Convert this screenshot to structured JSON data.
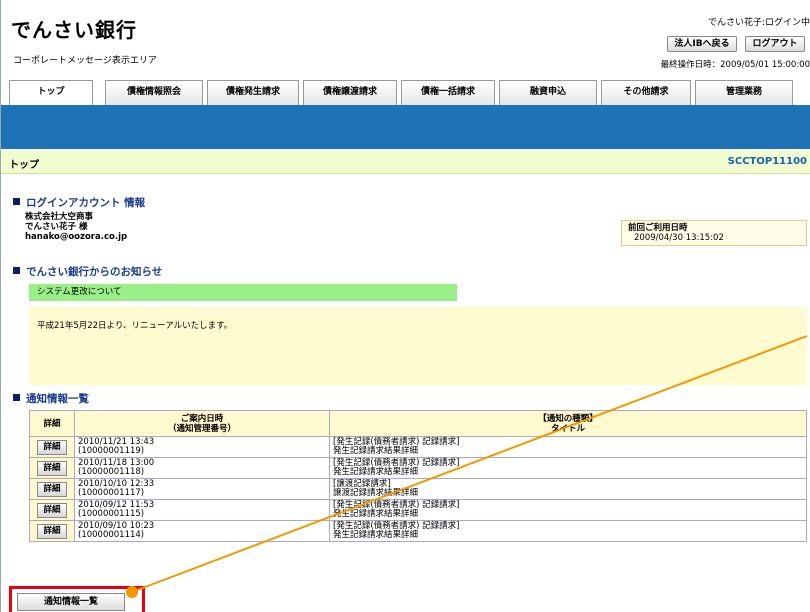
{
  "header": {
    "bank_name": "でんさい銀行",
    "corporate_message": "コーポレートメッセージ表示エリア",
    "user_name": "でんさい花子:ログイン中",
    "ib_return_label": "法人IBへ戻る",
    "logout_label": "ログアウト",
    "last_operation": "最終操作日時：2009/05/01 15:00:00"
  },
  "nav": {
    "tabs": [
      {
        "label": "トップ"
      },
      {
        "label": "債権情報照会"
      },
      {
        "label": "債権発生請求"
      },
      {
        "label": "債権譲渡請求"
      },
      {
        "label": "債権一括請求"
      },
      {
        "label": "融資申込"
      },
      {
        "label": "その他請求"
      },
      {
        "label": "管理業務"
      }
    ]
  },
  "page": {
    "title": "トップ",
    "screen_id": "SCCTOP11100"
  },
  "login_account": {
    "heading": "ログインアカウント 情報",
    "company": "株式会社大空商事",
    "user": "でんさい花子 様",
    "email": "hanako@oozora.co.jp",
    "prev_login_label": "前回ご利用日時",
    "prev_login_value": "2009/04/30 13:15:02"
  },
  "notices": {
    "heading": "でんさい銀行からのお知らせ",
    "title": "システム更改について",
    "body": "平成21年5月22日より、リニューアルいたします。"
  },
  "notifications": {
    "heading": "通知情報一覧",
    "col_detail": "詳細",
    "col_date_line1": "ご案内日時",
    "col_date_line2": "（通知管理番号）",
    "col_type_line1": "【通知の種類】",
    "col_type_line2": "タイトル",
    "detail_label": "詳細",
    "rows": [
      {
        "date": "2010/11/21 13:43",
        "number": "(10000001119)",
        "type": "[発生記録(債務者請求) 記録請求]",
        "title": "発生記録請求結果詳細"
      },
      {
        "date": "2010/11/18 13:00",
        "number": "(10000001118)",
        "type": "[発生記録(債務者請求) 記録請求]",
        "title": "発生記録請求結果詳細"
      },
      {
        "date": "2010/10/10 12:33",
        "number": "(10000001117)",
        "type": "[譲渡記録請求]",
        "title": "譲渡記録請求結果詳細"
      },
      {
        "date": "2010/09/12 11:53",
        "number": "(10000001115)",
        "type": "[発生記録(債務者請求) 記録請求]",
        "title": "発生記録請求結果詳細"
      },
      {
        "date": "2010/09/10 10:23",
        "number": "(10000001114)",
        "type": "[発生記録(債務者請求) 記録請求]",
        "title": "発生記録請求結果詳細"
      }
    ],
    "list_button_label": "通知情報一覧"
  },
  "colors": {
    "blue_bar": "#1e73b7",
    "crumb_bg": "#f2fed0",
    "notice_green": "#99ee88",
    "notice_yellow": "#fffbd0",
    "highlight_red": "#e60012",
    "callout_orange": "#f39800"
  }
}
